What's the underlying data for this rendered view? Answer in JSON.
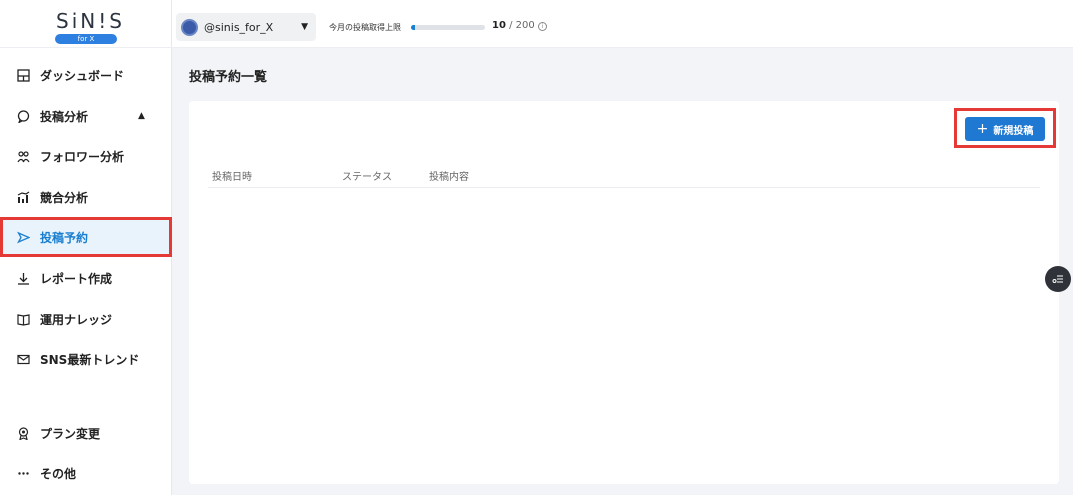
{
  "brand": {
    "logo_text": "SiN!S",
    "logo_sub": "for X"
  },
  "sidebar": {
    "items": [
      {
        "label": "ダッシュボード",
        "icon": "dashboard-icon"
      },
      {
        "label": "投稿分析",
        "icon": "chat-bubble-icon",
        "caret": "▲"
      },
      {
        "label": "フォロワー分析",
        "icon": "users-icon"
      },
      {
        "label": "競合分析",
        "icon": "bar-chart-icon"
      },
      {
        "label": "投稿予約",
        "icon": "send-icon",
        "active": true
      },
      {
        "label": "レポート作成",
        "icon": "download-icon"
      },
      {
        "label": "運用ナレッジ",
        "icon": "book-icon"
      },
      {
        "label": "SNS最新トレンド",
        "icon": "mail-icon"
      },
      {
        "label": "プラン変更",
        "icon": "badge-icon"
      },
      {
        "label": "その他",
        "icon": "more-icon"
      }
    ]
  },
  "topbar": {
    "account": "@sinis_for_X",
    "account_caret": "▼",
    "quota_label": "今月の投稿取得上限",
    "quota_used": "10",
    "quota_sep": " / ",
    "quota_total": "200",
    "quota_fraction": 0.05,
    "info": "i"
  },
  "main": {
    "title": "投稿予約一覧",
    "new_post_label": "新規投稿",
    "new_post_plus": "+",
    "columns": [
      "投稿日時",
      "ステータス",
      "投稿内容"
    ]
  },
  "colors": {
    "accent": "#1f78d1",
    "highlight": "#e53935",
    "active_bg": "#e8f3fb"
  }
}
